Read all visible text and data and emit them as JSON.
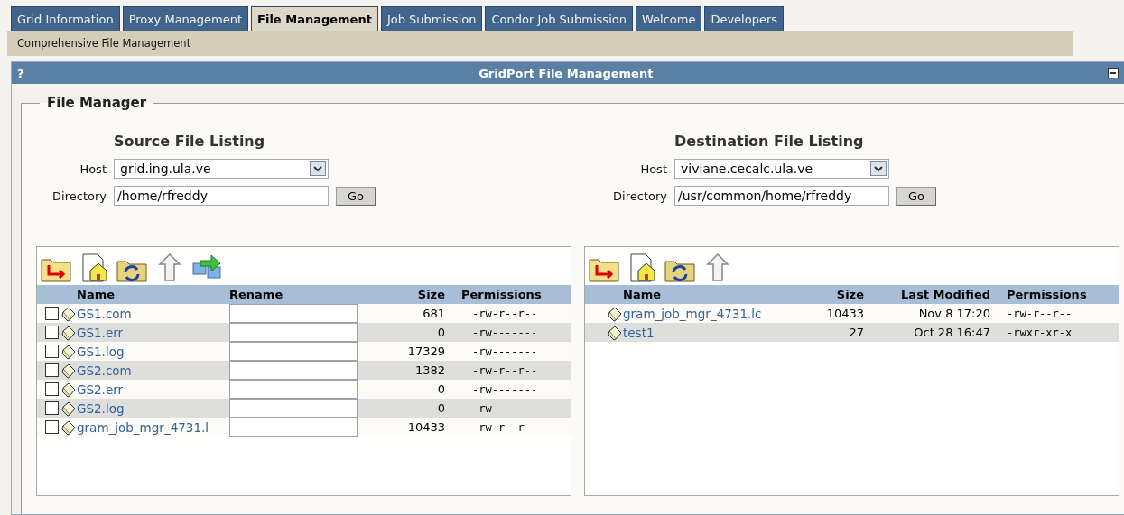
{
  "tabs": [
    {
      "label": "Grid Information",
      "selected": false
    },
    {
      "label": "Proxy Management",
      "selected": false
    },
    {
      "label": "File Management",
      "selected": true
    },
    {
      "label": "Job Submission",
      "selected": false
    },
    {
      "label": "Condor Job Submission",
      "selected": false
    },
    {
      "label": "Welcome",
      "selected": false
    },
    {
      "label": "Developers",
      "selected": false
    }
  ],
  "subtitle": "Comprehensive File Management",
  "panel": {
    "help": "?",
    "title": "GridPort File Management"
  },
  "fieldset": {
    "legend": "File Manager"
  },
  "source": {
    "heading": "Source File Listing",
    "host_label": "Host",
    "host": "grid.ing.ula.ve",
    "directory_label": "Directory",
    "directory": "/home/rfreddy",
    "go": "Go",
    "columns": [
      "Name",
      "Rename",
      "Size",
      "Permissions"
    ],
    "files": [
      {
        "name": "GS1.com",
        "size": "681",
        "permissions": "-rw-r--r--",
        "checked": false
      },
      {
        "name": "GS1.err",
        "size": "0",
        "permissions": "-rw-------",
        "checked": false
      },
      {
        "name": "GS1.log",
        "size": "17329",
        "permissions": "-rw-------",
        "checked": false
      },
      {
        "name": "GS2.com",
        "size": "1382",
        "permissions": "-rw-r--r--",
        "checked": false
      },
      {
        "name": "GS2.err",
        "size": "0",
        "permissions": "-rw-------",
        "checked": false
      },
      {
        "name": "GS2.log",
        "size": "0",
        "permissions": "-rw-------",
        "checked": false
      },
      {
        "name": "gram_job_mgr_4731.l",
        "size": "10433",
        "permissions": "-rw-r--r--",
        "checked": false
      }
    ]
  },
  "destination": {
    "heading": "Destination File Listing",
    "host_label": "Host",
    "host": "viviane.cecalc.ula.ve",
    "directory_label": "Directory",
    "directory": "/usr/common/home/rfreddy",
    "go": "Go",
    "columns": [
      "Name",
      "Size",
      "Last Modified",
      "Permissions"
    ],
    "files": [
      {
        "name": "gram_job_mgr_4731.lc",
        "size": "10433",
        "modified": "Nov 8 17:20",
        "permissions": "-rw-r--r--"
      },
      {
        "name": "test1",
        "size": "27",
        "modified": "Oct 28 16:47",
        "permissions": "-rwxr-xr-x"
      }
    ]
  }
}
